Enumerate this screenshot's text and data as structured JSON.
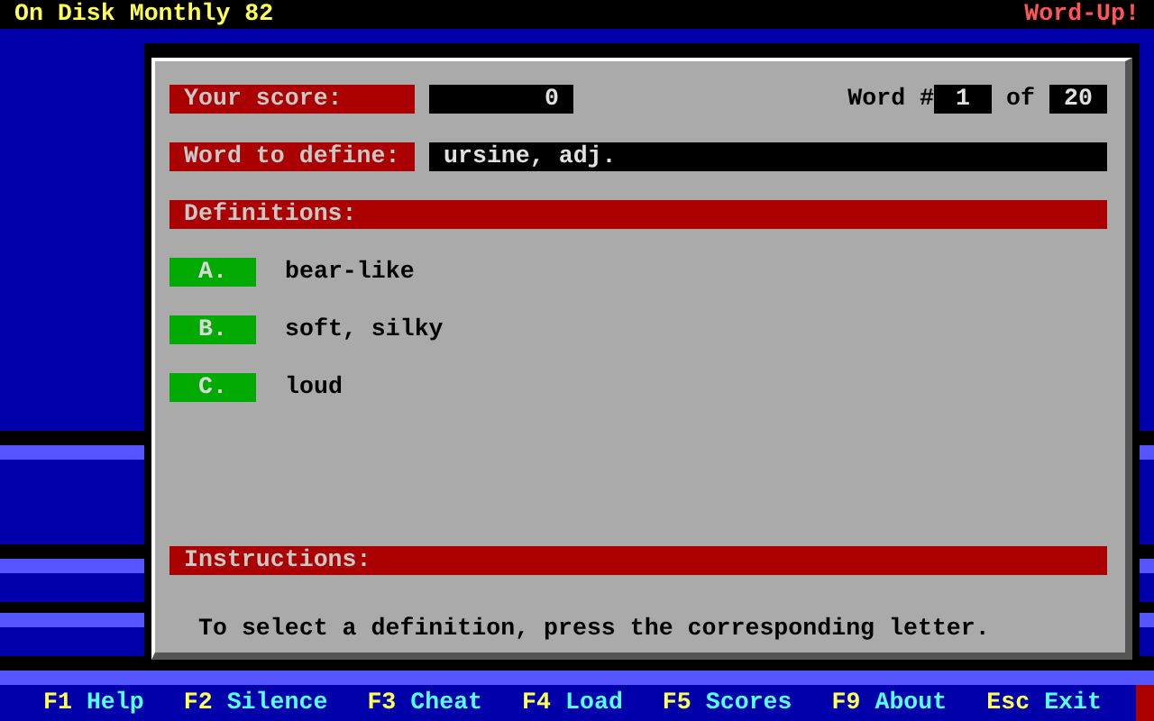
{
  "title_bar": {
    "title": "On Disk Monthly 82",
    "app_name": "Word-Up!"
  },
  "score": {
    "label": "Your score:",
    "value": "0"
  },
  "word_counter": {
    "label": "Word #",
    "current": "1",
    "separator": "of",
    "total": "20"
  },
  "word": {
    "label": "Word to define:",
    "value": "ursine, adj."
  },
  "definitions": {
    "header": "Definitions:",
    "options": [
      {
        "letter": "A.",
        "text": "bear-like"
      },
      {
        "letter": "B.",
        "text": "soft, silky"
      },
      {
        "letter": "C.",
        "text": "loud"
      }
    ]
  },
  "instructions": {
    "header": "Instructions:",
    "text": "To select a definition, press the corresponding letter."
  },
  "function_keys": [
    {
      "key": "F1",
      "label": "Help"
    },
    {
      "key": "F2",
      "label": "Silence"
    },
    {
      "key": "F3",
      "label": "Cheat"
    },
    {
      "key": "F4",
      "label": "Load"
    },
    {
      "key": "F5",
      "label": "Scores"
    },
    {
      "key": "F9",
      "label": "About"
    },
    {
      "key": "Esc",
      "label": "Exit"
    }
  ]
}
